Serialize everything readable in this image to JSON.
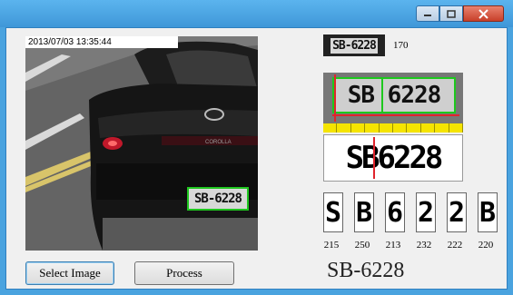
{
  "window": {
    "controls": {
      "minimize": "minimize-icon",
      "maximize": "maximize-icon",
      "close": "close-icon"
    }
  },
  "image": {
    "timestamp": "2013/07/03  13:35:44",
    "car_badge": "COROLLA",
    "detected_plate": "SB-6228"
  },
  "plate_thumbnail": {
    "text": "SB-6228",
    "score": "170"
  },
  "plate_crop": {
    "text": "SB 6228"
  },
  "binary_plate": {
    "text": "SB6228"
  },
  "characters": [
    {
      "glyph": "S",
      "score": "215"
    },
    {
      "glyph": "B",
      "score": "250"
    },
    {
      "glyph": "6",
      "score": "213"
    },
    {
      "glyph": "2",
      "score": "232"
    },
    {
      "glyph": "2",
      "score": "222"
    },
    {
      "glyph": "B",
      "score": "220"
    }
  ],
  "buttons": {
    "select_image": "Select Image",
    "process": "Process"
  },
  "result": {
    "plate": "SB-6228"
  }
}
